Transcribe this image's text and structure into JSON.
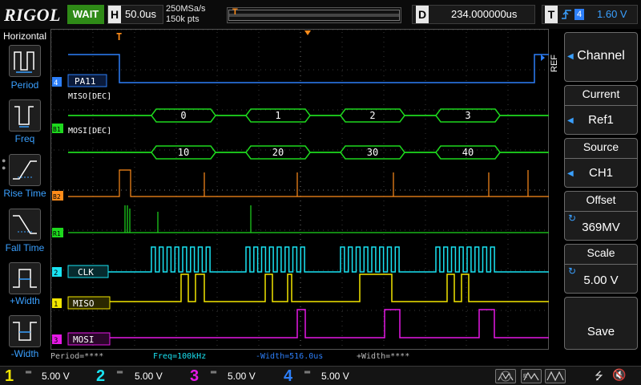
{
  "topbar": {
    "logo": "RIGOL",
    "run_state": "WAIT",
    "horizontal": {
      "letter": "H",
      "value": "50.0us"
    },
    "sample_rate": "250MSa/s",
    "memory_depth": "150k pts",
    "delay": {
      "letter": "D",
      "value": "234.000000us"
    },
    "trigger": {
      "letter": "T",
      "source": "4",
      "level": "1.60 V"
    }
  },
  "left_panel": {
    "title": "Horizontal",
    "buttons": [
      {
        "label": "Period",
        "icon": "period-icon"
      },
      {
        "label": "Freq",
        "icon": "frequency-icon"
      },
      {
        "label": "Rise Time",
        "icon": "rise-time-icon"
      },
      {
        "label": "Fall Time",
        "icon": "fall-time-icon"
      },
      {
        "label": "+Width",
        "icon": "positive-width-icon"
      },
      {
        "label": "-Width",
        "icon": "negative-width-icon"
      }
    ]
  },
  "right_panel": {
    "menu_tag": "REF",
    "channel": {
      "label": "Channel"
    },
    "current": {
      "title": "Current",
      "value": "Ref1"
    },
    "source": {
      "title": "Source",
      "value": "CH1"
    },
    "offset": {
      "title": "Offset",
      "value": "369MV"
    },
    "scale": {
      "title": "Scale",
      "value": "5.00 V"
    },
    "save": {
      "label": "Save"
    }
  },
  "waveforms": {
    "trace_labels": {
      "ch4": "PA11",
      "decode1": "MISO[DEC]",
      "decode2": "MOSI[DEC]",
      "ch2": "CLK",
      "ch1": "MISO",
      "ch3": "MOSI"
    },
    "trace_markers": {
      "ch4": "4",
      "b1": "B1",
      "b2": "B2",
      "r1": "R1",
      "ch2": "2",
      "ch1": "1",
      "ch3": "3"
    },
    "miso_decode_values": [
      "0",
      "1",
      "2",
      "3"
    ],
    "mosi_decode_values": [
      "10",
      "20",
      "30",
      "40"
    ]
  },
  "measurements": {
    "period": "Period=****",
    "freq": "Freq=100kHz",
    "neg_width": "-Width=516.0us",
    "pos_width": "+Width=****"
  },
  "channels": [
    {
      "number": "1",
      "scale": "5.00 V",
      "color": "#f2e600"
    },
    {
      "number": "2",
      "scale": "5.00 V",
      "color": "#19e3f2"
    },
    {
      "number": "3",
      "scale": "5.00 V",
      "color": "#e619e6"
    },
    {
      "number": "4",
      "scale": "5.00 V",
      "color": "#2d7ff9"
    }
  ],
  "colors": {
    "ch1": "#f2e600",
    "ch2": "#19e3f2",
    "ch3": "#e619e6",
    "ch4": "#2d7ff9",
    "decode": "#1ed81e",
    "ref": "#ff8c1a",
    "accent": "#3aa0ff",
    "run_state": "#2f8a17"
  }
}
